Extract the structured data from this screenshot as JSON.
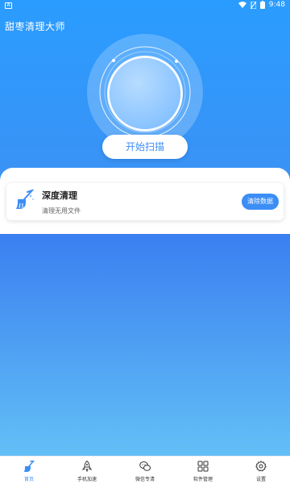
{
  "status_bar": {
    "time": "9:48",
    "icons": [
      "notification-icon",
      "wifi-icon",
      "no-sim-icon",
      "battery-icon"
    ]
  },
  "app": {
    "title": "甜枣清理大师"
  },
  "scan": {
    "button_label": "开始扫描"
  },
  "card": {
    "title": "深度清理",
    "subtitle": "清理无用文件",
    "button_label": "清除数据",
    "icon": "broom-icon"
  },
  "nav": {
    "items": [
      {
        "label": "首页",
        "icon": "broom-icon",
        "active": true
      },
      {
        "label": "手机加速",
        "icon": "rocket-icon",
        "active": false
      },
      {
        "label": "微信专清",
        "icon": "wechat-icon",
        "active": false
      },
      {
        "label": "软件管理",
        "icon": "apps-grid-icon",
        "active": false
      },
      {
        "label": "设置",
        "icon": "gear-icon",
        "active": false
      }
    ]
  },
  "colors": {
    "primary": "#3c8ef5",
    "header_top": "#2a9cff",
    "lower_gradient_start": "#3a7ff0",
    "lower_gradient_end": "#63bff6"
  }
}
